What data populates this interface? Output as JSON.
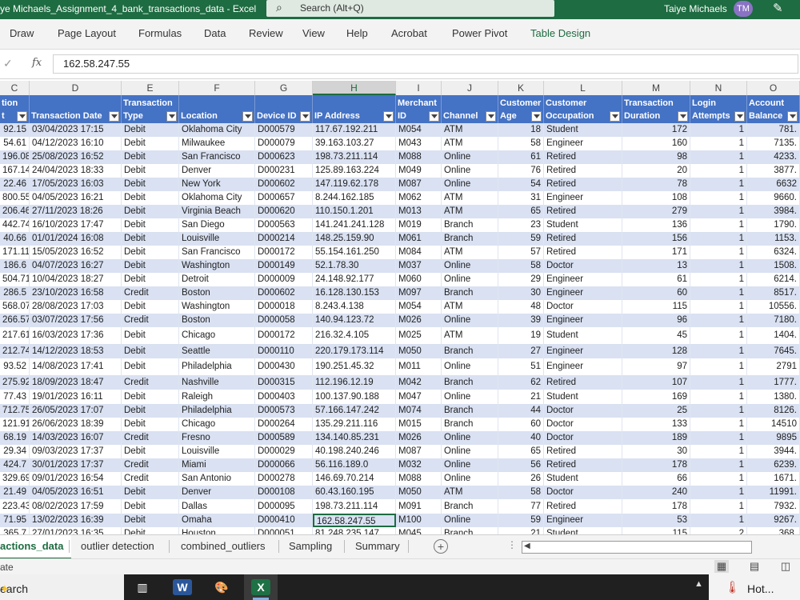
{
  "window": {
    "title": "ye Michaels_Assignment_4_bank_transactions_data  -  Excel",
    "search_placeholder": "Search (Alt+Q)",
    "user_name": "Taiye Michaels",
    "user_initials": "TM"
  },
  "ribbon": {
    "tabs": [
      "Draw",
      "Page Layout",
      "Formulas",
      "Data",
      "Review",
      "View",
      "Help",
      "Acrobat",
      "Power Pivot",
      "Table Design"
    ],
    "active_tab": "Table Design"
  },
  "formula_bar": {
    "cancel_glyph": "✓",
    "fx": "fx",
    "value": "162.58.247.55"
  },
  "columns": {
    "letters": [
      "C",
      "D",
      "E",
      "F",
      "G",
      "H",
      "I",
      "J",
      "K",
      "L",
      "M",
      "N",
      "O"
    ],
    "selected": "H"
  },
  "table": {
    "headers": [
      [
        "tion",
        "t"
      ],
      [
        "",
        "Transaction Date"
      ],
      [
        "Transaction",
        "Type"
      ],
      [
        "",
        "Location"
      ],
      [
        "",
        "Device ID"
      ],
      [
        "",
        "IP Address"
      ],
      [
        "Merchant",
        "ID"
      ],
      [
        "",
        "Channel"
      ],
      [
        "Customer",
        "Age"
      ],
      [
        "Customer",
        "Occupation"
      ],
      [
        "Transaction",
        "Duration"
      ],
      [
        "Login",
        "Attempts"
      ],
      [
        "Account",
        "Balance"
      ]
    ],
    "rows": [
      [
        "92.15",
        "03/04/2023 17:15",
        "Debit",
        "Oklahoma City",
        "D000579",
        "117.67.192.211",
        "M054",
        "ATM",
        "18",
        "Student",
        "172",
        "1",
        "781."
      ],
      [
        "54.61",
        "04/12/2023 16:10",
        "Debit",
        "Milwaukee",
        "D000079",
        "39.163.103.27",
        "M043",
        "ATM",
        "58",
        "Engineer",
        "160",
        "1",
        "7135."
      ],
      [
        "196.08",
        "25/08/2023 16:52",
        "Debit",
        "San Francisco",
        "D000623",
        "198.73.211.114",
        "M088",
        "Online",
        "61",
        "Retired",
        "98",
        "1",
        "4233."
      ],
      [
        "167.14",
        "24/04/2023 18:33",
        "Debit",
        "Denver",
        "D000231",
        "125.89.163.224",
        "M049",
        "Online",
        "76",
        "Retired",
        "20",
        "1",
        "3877."
      ],
      [
        "22.46",
        "17/05/2023 16:03",
        "Debit",
        "New York",
        "D000602",
        "147.119.62.178",
        "M087",
        "Online",
        "54",
        "Retired",
        "78",
        "1",
        "6632"
      ],
      [
        "800.55",
        "04/05/2023 16:21",
        "Debit",
        "Oklahoma City",
        "D000657",
        "8.244.162.185",
        "M062",
        "ATM",
        "31",
        "Engineer",
        "108",
        "1",
        "9660."
      ],
      [
        "206.46",
        "27/11/2023 18:26",
        "Debit",
        "Virginia Beach",
        "D000620",
        "110.150.1.201",
        "M013",
        "ATM",
        "65",
        "Retired",
        "279",
        "1",
        "3984."
      ],
      [
        "442.74",
        "16/10/2023 17:47",
        "Debit",
        "San Diego",
        "D000563",
        "141.241.241.128",
        "M019",
        "Branch",
        "23",
        "Student",
        "136",
        "1",
        "1790."
      ],
      [
        "40.66",
        "01/01/2024 16:08",
        "Debit",
        "Louisville",
        "D000214",
        "148.25.159.90",
        "M061",
        "Branch",
        "59",
        "Retired",
        "156",
        "1",
        "1153."
      ],
      [
        "171.11",
        "15/05/2023 16:52",
        "Debit",
        "San Francisco",
        "D000172",
        "55.154.161.250",
        "M084",
        "ATM",
        "57",
        "Retired",
        "171",
        "1",
        "6324."
      ],
      [
        "186.6",
        "04/07/2023 16:27",
        "Debit",
        "Washington",
        "D000149",
        "52.1.78.30",
        "M037",
        "Online",
        "58",
        "Doctor",
        "13",
        "1",
        "1508."
      ],
      [
        "504.71",
        "10/04/2023 18:27",
        "Debit",
        "Detroit",
        "D000009",
        "24.148.92.177",
        "M060",
        "Online",
        "29",
        "Engineer",
        "61",
        "1",
        "6214."
      ],
      [
        "286.5",
        "23/10/2023 16:58",
        "Credit",
        "Boston",
        "D000602",
        "16.128.130.153",
        "M097",
        "Branch",
        "30",
        "Engineer",
        "60",
        "1",
        "8517."
      ],
      [
        "568.07",
        "28/08/2023 17:03",
        "Debit",
        "Washington",
        "D000018",
        "8.243.4.138",
        "M054",
        "ATM",
        "48",
        "Doctor",
        "115",
        "1",
        "10556."
      ],
      [
        "266.57",
        "03/07/2023 17:56",
        "Credit",
        "Boston",
        "D000058",
        "140.94.123.72",
        "M026",
        "Online",
        "39",
        "Engineer",
        "96",
        "1",
        "7180."
      ],
      [
        "217.61",
        "16/03/2023 17:36",
        "Debit",
        "Chicago",
        "D000172",
        "216.32.4.105",
        "M025",
        "ATM",
        "19",
        "Student",
        "45",
        "1",
        "1404."
      ],
      [
        "212.74",
        "14/12/2023 18:53",
        "Debit",
        "Seattle",
        "D000110",
        "220.179.173.114",
        "M050",
        "Branch",
        "27",
        "Engineer",
        "128",
        "1",
        "7645."
      ],
      [
        "93.52",
        "14/08/2023 17:41",
        "Debit",
        "Philadelphia",
        "D000430",
        "190.251.45.32",
        "M011",
        "Online",
        "51",
        "Engineer",
        "97",
        "1",
        "2791"
      ],
      [
        "275.92",
        "18/09/2023 18:47",
        "Credit",
        "Nashville",
        "D000315",
        "112.196.12.19",
        "M042",
        "Branch",
        "62",
        "Retired",
        "107",
        "1",
        "1777."
      ],
      [
        "77.43",
        "19/01/2023 16:11",
        "Debit",
        "Raleigh",
        "D000403",
        "100.137.90.188",
        "M047",
        "Online",
        "21",
        "Student",
        "169",
        "1",
        "1380."
      ],
      [
        "712.75",
        "26/05/2023 17:07",
        "Debit",
        "Philadelphia",
        "D000573",
        "57.166.147.242",
        "M074",
        "Branch",
        "44",
        "Doctor",
        "25",
        "1",
        "8126."
      ],
      [
        "121.91",
        "26/06/2023 18:39",
        "Debit",
        "Chicago",
        "D000264",
        "135.29.211.116",
        "M015",
        "Branch",
        "60",
        "Doctor",
        "133",
        "1",
        "14510"
      ],
      [
        "68.19",
        "14/03/2023 16:07",
        "Credit",
        "Fresno",
        "D000589",
        "134.140.85.231",
        "M026",
        "Online",
        "40",
        "Doctor",
        "189",
        "1",
        "9895"
      ],
      [
        "29.34",
        "09/03/2023 17:37",
        "Debit",
        "Louisville",
        "D000029",
        "40.198.240.246",
        "M087",
        "Online",
        "65",
        "Retired",
        "30",
        "1",
        "3944."
      ],
      [
        "424.7",
        "30/01/2023 17:37",
        "Credit",
        "Miami",
        "D000066",
        "56.116.189.0",
        "M032",
        "Online",
        "56",
        "Retired",
        "178",
        "1",
        "6239."
      ],
      [
        "329.69",
        "09/01/2023 16:54",
        "Credit",
        "San Antonio",
        "D000278",
        "146.69.70.214",
        "M088",
        "Online",
        "26",
        "Student",
        "66",
        "1",
        "1671."
      ],
      [
        "21.49",
        "04/05/2023 16:51",
        "Debit",
        "Denver",
        "D000108",
        "60.43.160.195",
        "M050",
        "ATM",
        "58",
        "Doctor",
        "240",
        "1",
        "11991."
      ],
      [
        "223.43",
        "08/02/2023 17:59",
        "Debit",
        "Dallas",
        "D000095",
        "198.73.211.114",
        "M091",
        "Branch",
        "77",
        "Retired",
        "178",
        "1",
        "7932."
      ],
      [
        "71.95",
        "13/02/2023 16:39",
        "Debit",
        "Omaha",
        "D000410",
        "162.58.247.55",
        "M100",
        "Online",
        "59",
        "Engineer",
        "53",
        "1",
        "9267."
      ],
      [
        "365.7",
        "27/01/2023 16:35",
        "Debit",
        "Houston",
        "D000051",
        "81.248.235.147",
        "M045",
        "Branch",
        "21",
        "Student",
        "115",
        "2",
        "368."
      ]
    ],
    "selected_row_index": 28
  },
  "sheet_tabs": {
    "tabs": [
      "actions_data",
      "outlier detection",
      "combined_outliers",
      "Sampling",
      "Summary"
    ],
    "active": "actions_data",
    "add_glyph": "+",
    "more_glyph": "⋮"
  },
  "status": {
    "text": "ate"
  },
  "taskbar": {
    "search_text": "earch",
    "weather_text": "Hot..."
  },
  "colors": {
    "excel_green": "#1e6c41",
    "table_header_blue": "#4472c4",
    "band_blue": "#d9e1f2"
  }
}
